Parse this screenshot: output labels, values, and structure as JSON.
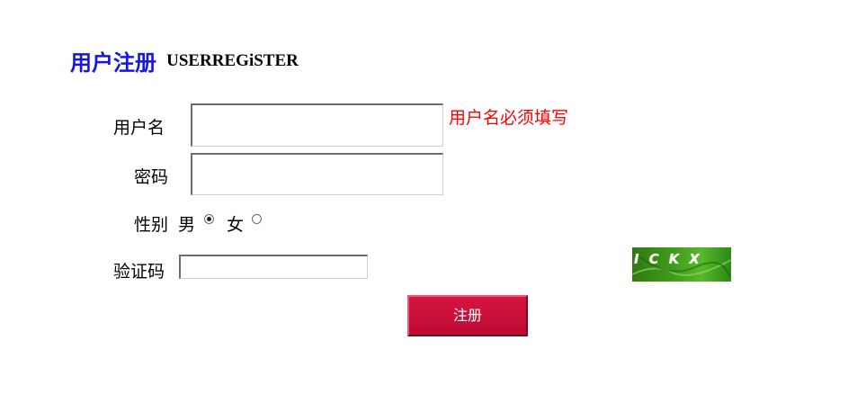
{
  "page": {
    "title_cn": "用户注册",
    "title_en": "USERREGiSTER"
  },
  "form": {
    "username": {
      "label": "用户名",
      "value": "",
      "error": "用户名必须填写"
    },
    "password": {
      "label": "密码",
      "value": ""
    },
    "gender": {
      "label": "性别",
      "options": [
        {
          "label": "男",
          "selected": true
        },
        {
          "label": "女",
          "selected": false
        }
      ]
    },
    "captcha": {
      "label": "验证码",
      "value": "",
      "image_text": "ICKX"
    },
    "submit_label": "注册"
  },
  "colors": {
    "title": "#1515e6",
    "error": "#ff0000",
    "button": "#c90f38"
  }
}
